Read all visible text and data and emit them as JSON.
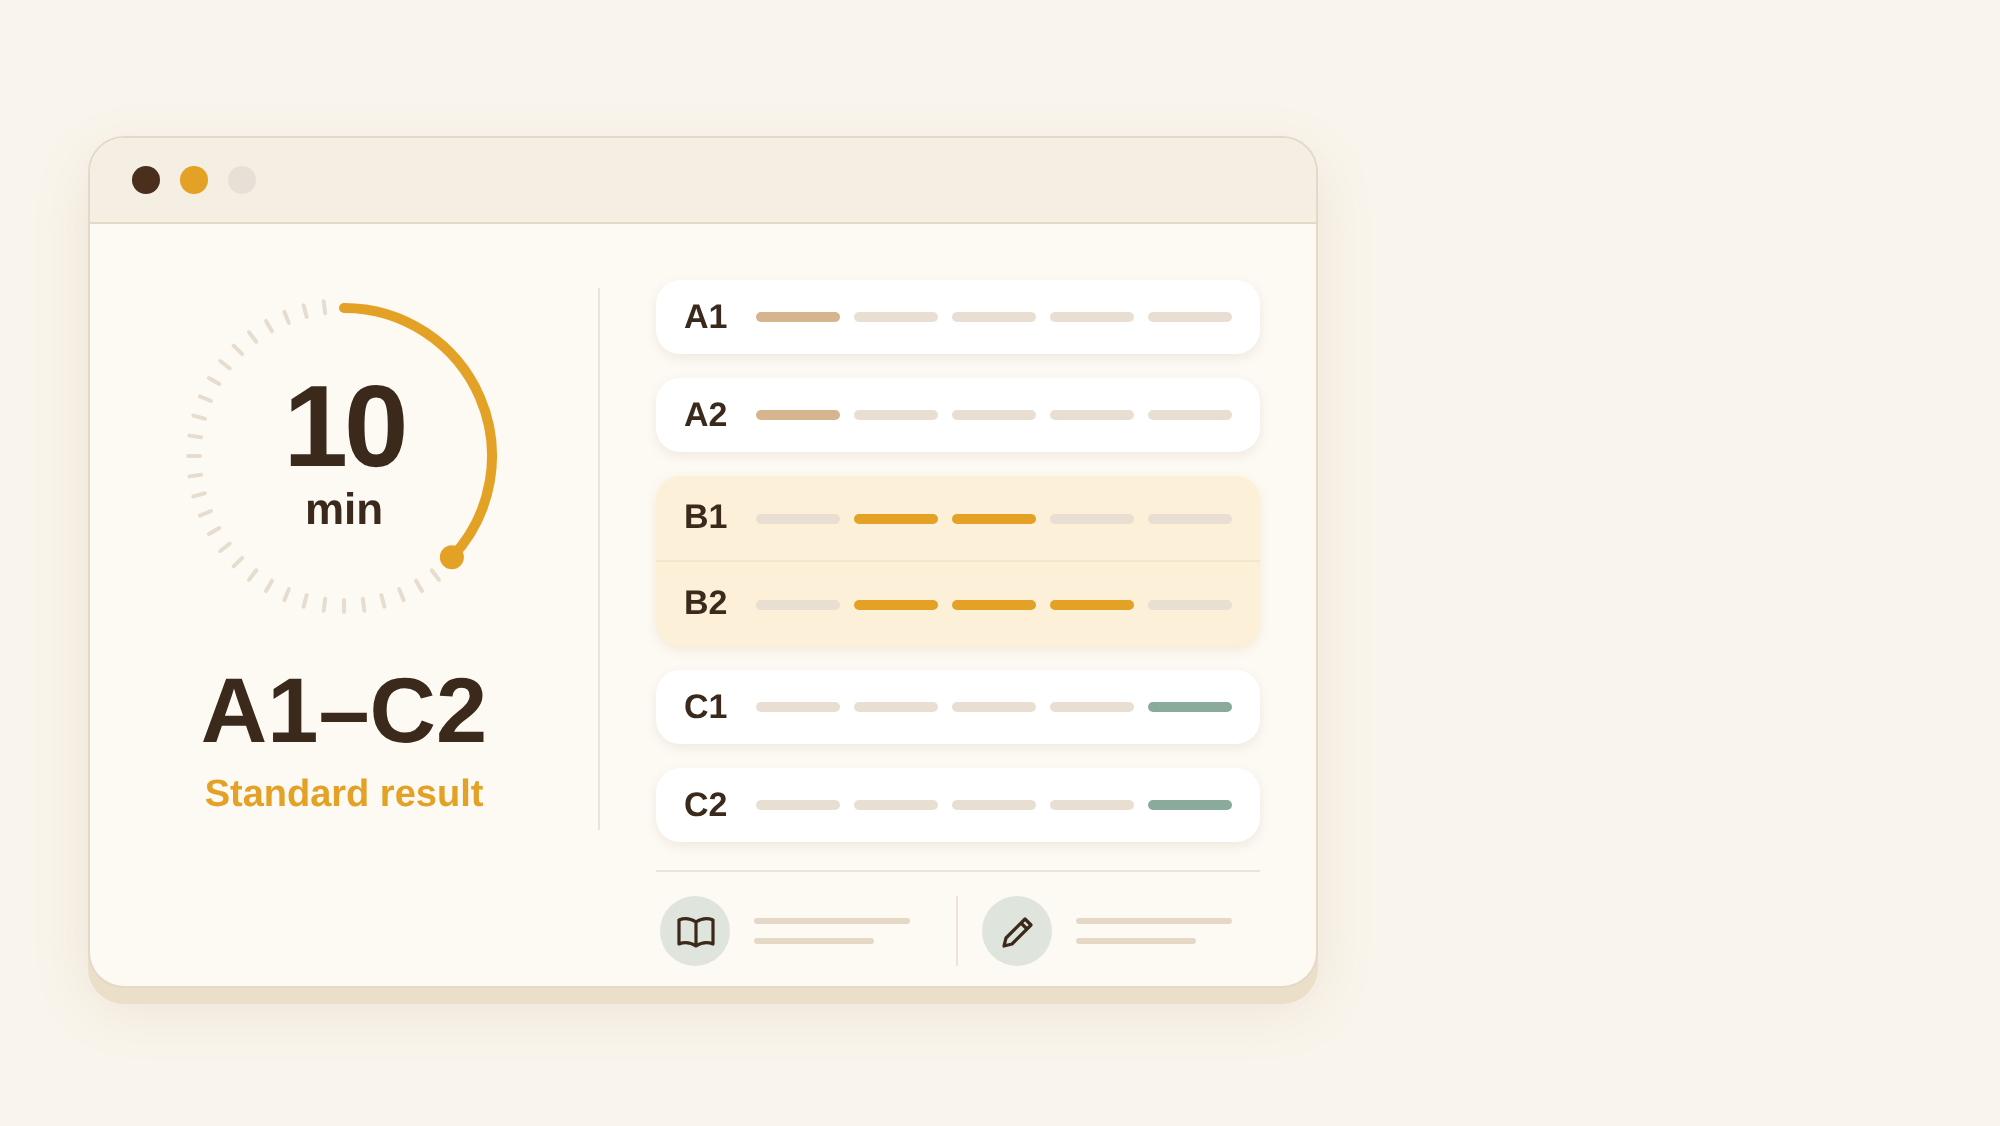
{
  "window": {
    "controls": [
      {
        "color": "#4a2f1c"
      },
      {
        "color": "#e3a126"
      },
      {
        "color": "#e6e0d6"
      }
    ]
  },
  "timer": {
    "value": "10",
    "unit": "min"
  },
  "range": "A1–C2",
  "result": "Standard result",
  "groups": [
    {
      "highlighted": false,
      "rows": [
        {
          "label": "A1",
          "segments": [
            {
              "color": "#d6b48e"
            },
            {
              "color": "#e8dfd2"
            },
            {
              "color": "#e8dfd2"
            },
            {
              "color": "#e8dfd2"
            },
            {
              "color": "#e8dfd2"
            }
          ]
        }
      ]
    },
    {
      "highlighted": false,
      "rows": [
        {
          "label": "A2",
          "segments": [
            {
              "color": "#d6b48e"
            },
            {
              "color": "#e8dfd2"
            },
            {
              "color": "#e8dfd2"
            },
            {
              "color": "#e8dfd2"
            },
            {
              "color": "#e8dfd2"
            }
          ]
        }
      ]
    },
    {
      "highlighted": true,
      "rows": [
        {
          "label": "B1",
          "segments": [
            {
              "color": "#e8dfd2"
            },
            {
              "color": "#e3a126"
            },
            {
              "color": "#e3a126"
            },
            {
              "color": "#e8dfd2"
            },
            {
              "color": "#e8dfd2"
            }
          ]
        },
        {
          "label": "B2",
          "segments": [
            {
              "color": "#e8dfd2"
            },
            {
              "color": "#e3a126"
            },
            {
              "color": "#e3a126"
            },
            {
              "color": "#e3a126"
            },
            {
              "color": "#e8dfd2"
            }
          ]
        }
      ]
    },
    {
      "highlighted": false,
      "rows": [
        {
          "label": "C1",
          "segments": [
            {
              "color": "#e8dfd2"
            },
            {
              "color": "#e8dfd2"
            },
            {
              "color": "#e8dfd2"
            },
            {
              "color": "#e8dfd2"
            },
            {
              "color": "#8aaa9c"
            }
          ]
        }
      ]
    },
    {
      "highlighted": false,
      "rows": [
        {
          "label": "C2",
          "segments": [
            {
              "color": "#e8dfd2"
            },
            {
              "color": "#e8dfd2"
            },
            {
              "color": "#e8dfd2"
            },
            {
              "color": "#e8dfd2"
            },
            {
              "color": "#8aaa9c"
            }
          ]
        }
      ]
    }
  ],
  "footer": [
    {
      "kind": "book"
    },
    {
      "kind": "pencil"
    }
  ]
}
